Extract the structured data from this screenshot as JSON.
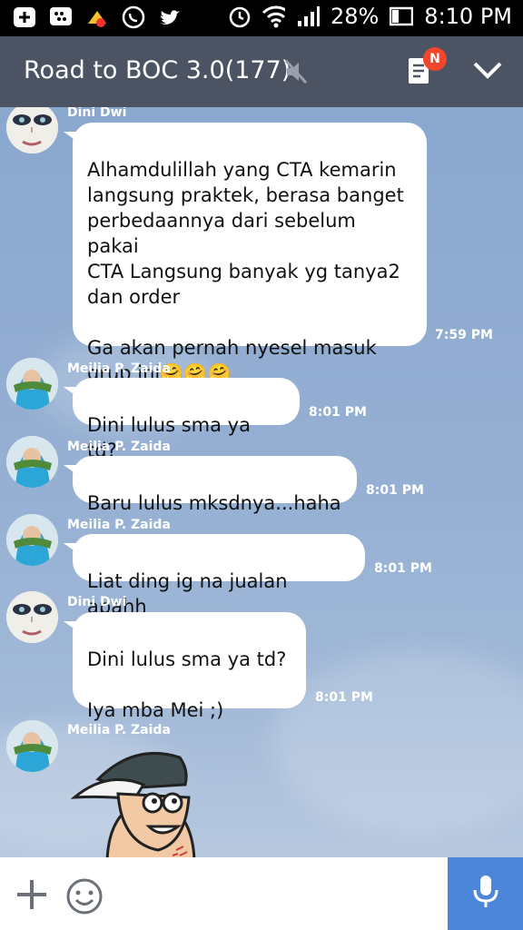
{
  "status_bar": {
    "battery": "28%",
    "time": "8:10 PM",
    "icons": [
      "add-icon",
      "bbm-icon",
      "game-notify-icon",
      "whatsapp-icon",
      "twitter-icon",
      "alarm-icon",
      "wifi-icon",
      "signal-icon",
      "battery-icon"
    ]
  },
  "header": {
    "title": "Road to BOC 3.0(177)",
    "badge": "N",
    "icons": [
      "mute-icon",
      "notes-icon",
      "chevron-down-icon"
    ]
  },
  "messages": [
    {
      "sender": "Dini Dwi",
      "text": "Alhamdulillah yang CTA kemarin\nlangsung praktek, berasa banget\nperbedaannya dari sebelum pakai\nCTA Langsung banyak yg tanya2\ndan order\n\nGa akan pernah nyesel masuk\ngrup ini",
      "emoji": "🤗🤗🤗",
      "time": "7:59 PM"
    },
    {
      "sender": "Meilia P. Zaida",
      "text": "Dini lulus sma ya td?",
      "time": "8:01 PM"
    },
    {
      "sender": "Meilia P. Zaida",
      "text": "Baru lulus mksdnya...haha",
      "time": "8:01 PM"
    },
    {
      "sender": "Meilia P. Zaida",
      "text": "Liat ding ig na jualan apahh",
      "time": "8:01 PM"
    },
    {
      "sender": "Dini Dwi",
      "text": "Dini lulus sma ya td?\n\nIya mba Mei ;)",
      "time": "8:01 PM"
    },
    {
      "sender": "Meilia P. Zaida",
      "sticker": "cartoon-boy-cap-sticker"
    }
  ],
  "input_bar": {
    "icons": [
      "plus-icon",
      "emoji-icon",
      "microphone-icon"
    ]
  },
  "colors": {
    "header_bg": "#4c5363",
    "chat_bg": "#8ea9cf",
    "mic_bg": "#4b86db",
    "badge_bg": "#f0462c"
  }
}
